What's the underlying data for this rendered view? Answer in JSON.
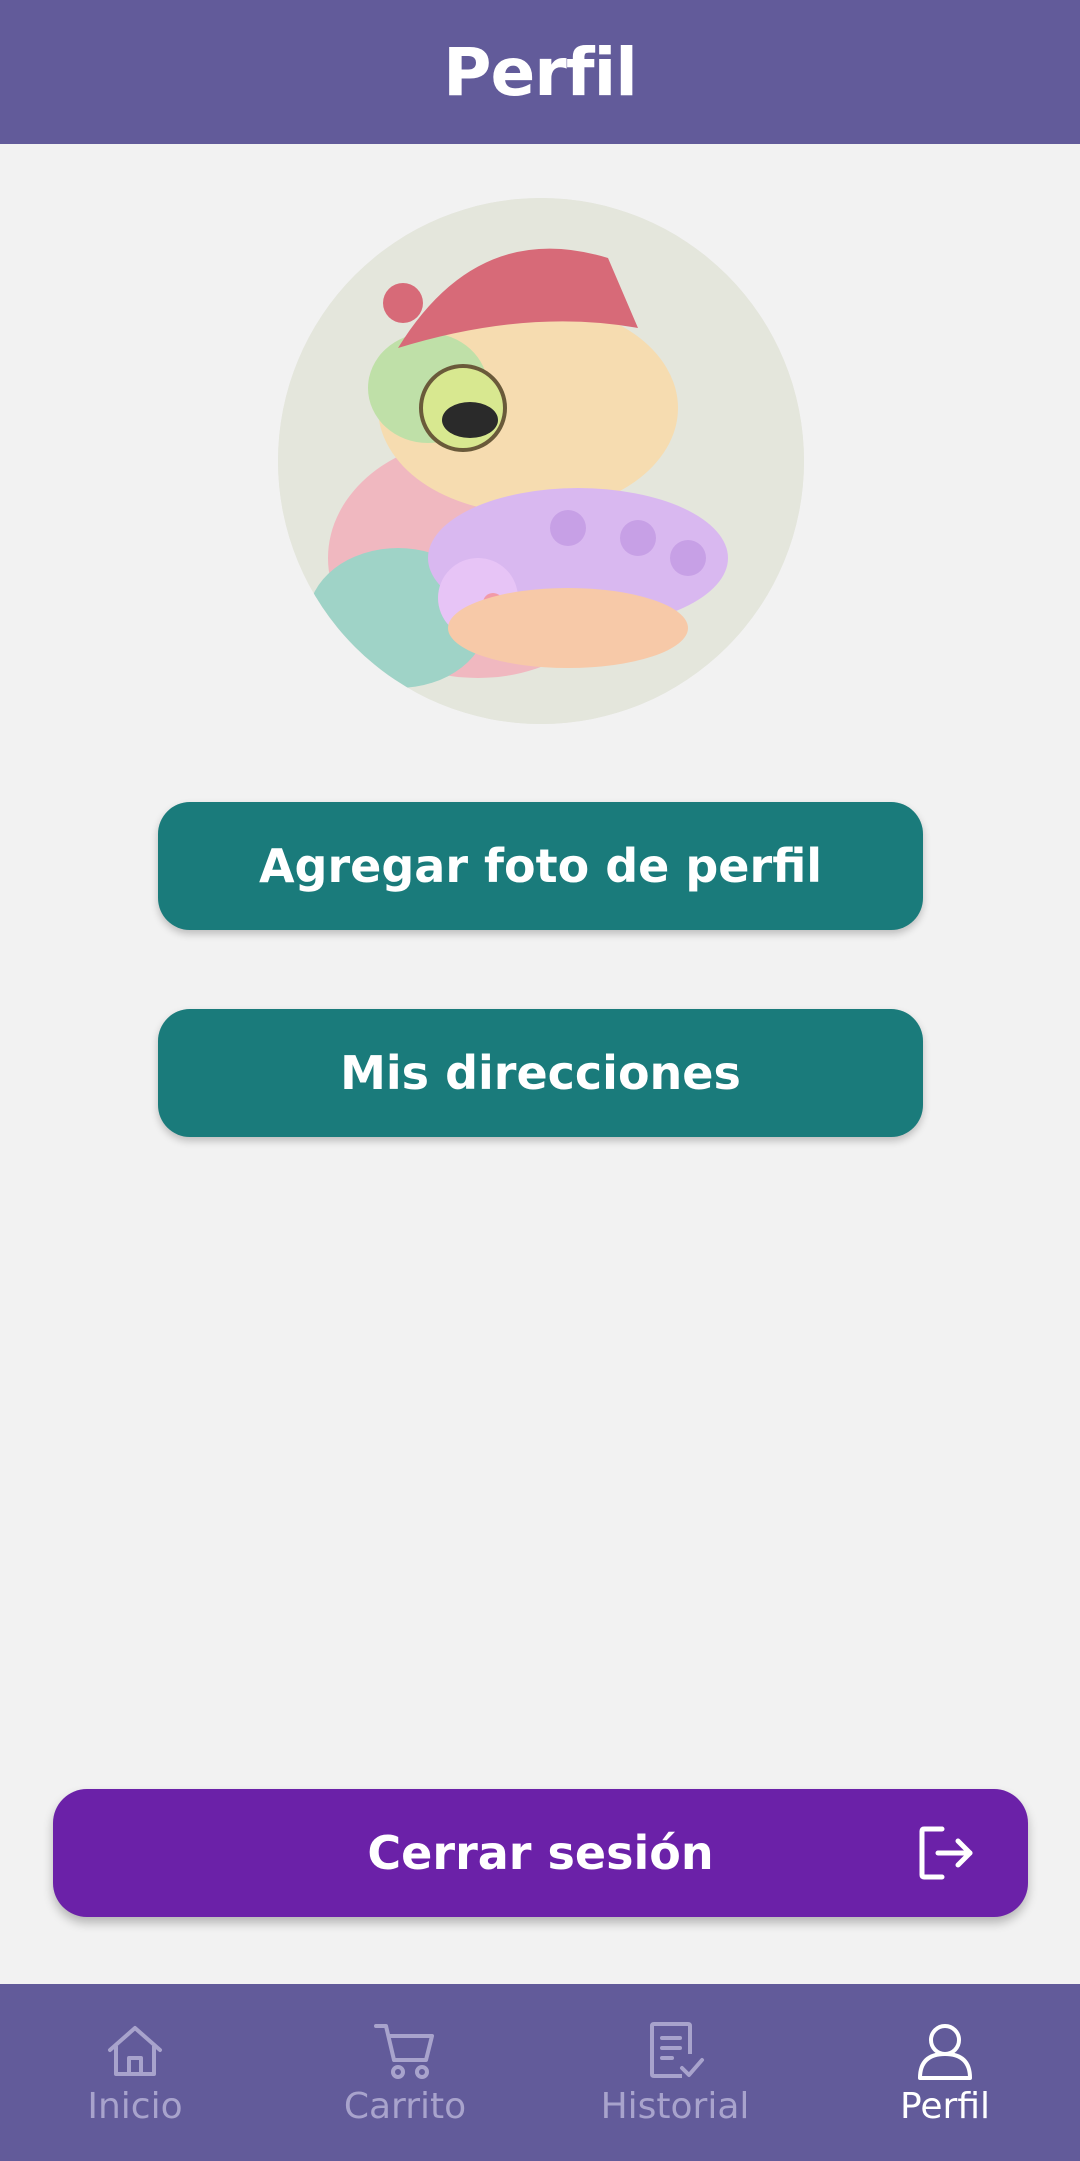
{
  "header": {
    "title": "Perfil",
    "background": "#625b9a"
  },
  "profile": {
    "avatar_icon": "profile-photo-frog"
  },
  "actions": {
    "add_photo_label": "Agregar foto de perfil",
    "addresses_label": "Mis direcciones",
    "color": "#1a7b7b"
  },
  "logout": {
    "label": "Cerrar sesión",
    "icon": "logout-icon",
    "color": "#6b21a8"
  },
  "bottom_nav": {
    "items": [
      {
        "label": "Inicio",
        "icon": "home-icon",
        "active": false
      },
      {
        "label": "Carrito",
        "icon": "cart-icon",
        "active": false
      },
      {
        "label": "Historial",
        "icon": "history-icon",
        "active": false
      },
      {
        "label": "Perfil",
        "icon": "user-icon",
        "active": true
      }
    ],
    "active_color": "#ffffff",
    "inactive_color": "#a8a3cc"
  }
}
